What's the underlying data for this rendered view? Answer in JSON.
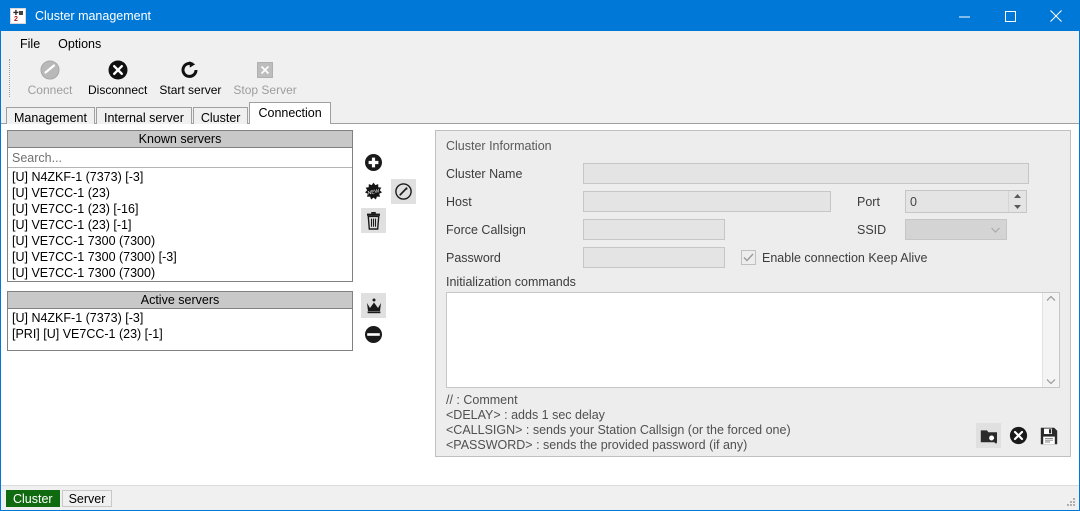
{
  "window": {
    "title": "Cluster management",
    "app_icon": "cluster-app-icon",
    "controls": {
      "minimize": "minimize-icon",
      "maximize": "maximize-icon",
      "close": "close-icon"
    },
    "accent_color": "#0078d7"
  },
  "menubar": {
    "items": [
      {
        "label": "File"
      },
      {
        "label": "Options"
      }
    ]
  },
  "toolbar": {
    "buttons": [
      {
        "label": "Connect",
        "icon": "connect-icon",
        "enabled": false
      },
      {
        "label": "Disconnect",
        "icon": "disconnect-icon",
        "enabled": true
      },
      {
        "label": "Start server",
        "icon": "refresh-icon",
        "enabled": true
      },
      {
        "label": "Stop Server",
        "icon": "stop-icon",
        "enabled": false
      }
    ]
  },
  "tabs": {
    "items": [
      {
        "label": "Management",
        "active": false
      },
      {
        "label": "Internal server",
        "active": false
      },
      {
        "label": "Cluster",
        "active": false
      },
      {
        "label": "Connection",
        "active": true
      }
    ]
  },
  "known_servers": {
    "header": "Known servers",
    "search_placeholder": "Search...",
    "search_value": "",
    "items": [
      "[U] N4ZKF-1 (7373) [-3]",
      "[U] VE7CC-1 (23)",
      "[U] VE7CC-1 (23) [-16]",
      "[U] VE7CC-1 (23) [-1]",
      "[U] VE7CC-1 7300 (7300)",
      "[U] VE7CC-1 7300 (7300) [-3]",
      "[U] VE7CC-1 7300 (7300)"
    ],
    "buttons": [
      {
        "name": "add-server-button",
        "icon": "plus-circle-icon"
      },
      {
        "name": "new-server-button",
        "icon": "new-badge-icon"
      },
      {
        "name": "edit-server-button",
        "icon": "edit-pencil-circle-icon"
      },
      {
        "name": "delete-server-button",
        "icon": "trash-icon"
      }
    ]
  },
  "active_servers": {
    "header": "Active servers",
    "items": [
      "[U] N4ZKF-1 (7373) [-3]",
      "[PRI] [U] VE7CC-1 (23) [-1]"
    ],
    "buttons": [
      {
        "name": "set-primary-button",
        "icon": "crown-icon"
      },
      {
        "name": "remove-active-button",
        "icon": "minus-circle-icon"
      }
    ]
  },
  "cluster_info": {
    "title": "Cluster Information",
    "fields": {
      "cluster_name": {
        "label": "Cluster Name",
        "value": ""
      },
      "host": {
        "label": "Host",
        "value": ""
      },
      "port": {
        "label": "Port",
        "value": "0"
      },
      "force_callsign": {
        "label": "Force Callsign",
        "value": ""
      },
      "ssid": {
        "label": "SSID",
        "value": ""
      },
      "password": {
        "label": "Password",
        "value": ""
      }
    },
    "keep_alive": {
      "label": "Enable connection Keep Alive",
      "checked": true
    },
    "init_commands": {
      "label": "Initialization commands",
      "value": "",
      "help": [
        "// : Comment",
        "<DELAY> : adds 1 sec delay",
        "<CALLSIGN> : sends your Station Callsign (or the forced one)",
        "<PASSWORD> : sends the provided password (if any)"
      ]
    },
    "buttons": [
      {
        "name": "browse-file-button",
        "icon": "folder-search-icon"
      },
      {
        "name": "clear-button",
        "icon": "x-circle-icon"
      },
      {
        "name": "save-button",
        "icon": "floppy-save-icon"
      }
    ]
  },
  "statusbar": {
    "cells": [
      {
        "label": "Cluster",
        "highlight": true,
        "color": "#106b10"
      },
      {
        "label": "Server",
        "highlight": false,
        "color": "#f0f0f0"
      }
    ]
  }
}
